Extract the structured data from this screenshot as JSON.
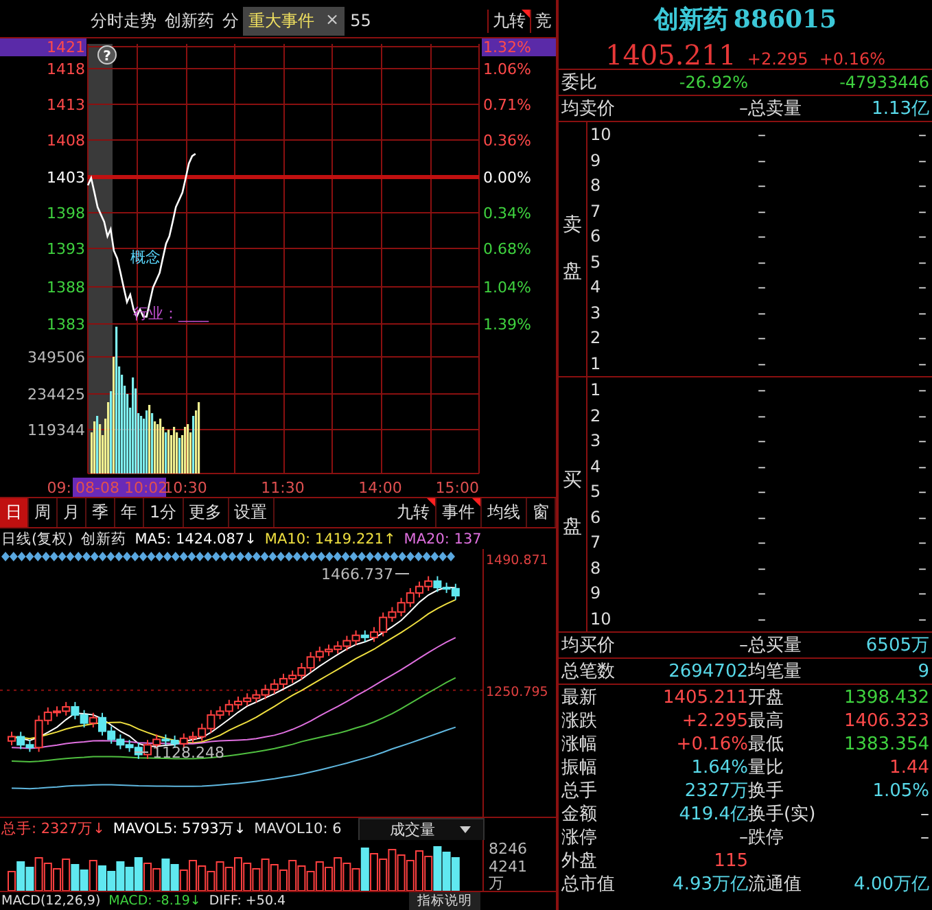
{
  "top_tabs": [
    {
      "label": "分时走势"
    },
    {
      "label": "创新药"
    },
    {
      "label": "分"
    }
  ],
  "event_popup": {
    "label": "重大事件",
    "close": "×",
    "trailing": "55"
  },
  "top_right_tabs": [
    {
      "label": "九转",
      "flagged": true
    },
    {
      "label": "竞",
      "flagged": false
    }
  ],
  "intraday": {
    "help": "?",
    "cursor_time": "08-08 10:02",
    "price_axis": [
      {
        "label": "1421",
        "kind": "up",
        "selected": true
      },
      {
        "label": "1418",
        "kind": "up",
        "selected": false
      },
      {
        "label": "1413",
        "kind": "up",
        "selected": false
      },
      {
        "label": "1408",
        "kind": "up",
        "selected": false
      },
      {
        "label": "1403",
        "kind": "flat",
        "selected": false
      },
      {
        "label": "1398",
        "kind": "down",
        "selected": false
      },
      {
        "label": "1393",
        "kind": "down",
        "selected": false
      },
      {
        "label": "1388",
        "kind": "down",
        "selected": false
      },
      {
        "label": "1383",
        "kind": "down",
        "selected": false
      }
    ],
    "percent_axis": [
      {
        "label": "1.32%",
        "kind": "up",
        "selected": true
      },
      {
        "label": "1.06%",
        "kind": "up",
        "selected": false
      },
      {
        "label": "0.71%",
        "kind": "up",
        "selected": false
      },
      {
        "label": "0.36%",
        "kind": "up",
        "selected": false
      },
      {
        "label": "0.00%",
        "kind": "flat",
        "selected": false
      },
      {
        "label": "0.34%",
        "kind": "down",
        "selected": false
      },
      {
        "label": "0.68%",
        "kind": "down",
        "selected": false
      },
      {
        "label": "1.04%",
        "kind": "down",
        "selected": false
      },
      {
        "label": "1.39%",
        "kind": "down",
        "selected": false
      }
    ],
    "volume_axis": [
      "349506",
      "234425",
      "119344"
    ],
    "time_axis": [
      "09:",
      "10:30",
      "11:30",
      "14:00",
      "15:00"
    ],
    "overlays": [
      {
        "text": "概念",
        "kind": "concept"
      },
      {
        "text": "行业：____",
        "kind": "industry"
      }
    ]
  },
  "period_tabs": [
    {
      "label": "日",
      "selected": true
    },
    {
      "label": "周",
      "selected": false
    },
    {
      "label": "月",
      "selected": false
    },
    {
      "label": "季",
      "selected": false
    },
    {
      "label": "年",
      "selected": false
    },
    {
      "label": "1分",
      "selected": false
    },
    {
      "label": "更多",
      "selected": false
    },
    {
      "label": "设置",
      "selected": false
    }
  ],
  "chart_tools": [
    {
      "label": "九转",
      "flagged": true
    },
    {
      "label": "事件",
      "flagged": true
    },
    {
      "label": "均线",
      "flagged": false
    },
    {
      "label": "窗",
      "flagged": false
    }
  ],
  "kline": {
    "legend": [
      {
        "text": "日线(复权)",
        "kind": "plain"
      },
      {
        "text": "创新药",
        "kind": "plain"
      },
      {
        "text": "MA5: 1424.087↓",
        "kind": "ma5"
      },
      {
        "text": "MA10: 1419.221↑",
        "kind": "ma10"
      },
      {
        "text": "MA20: 137",
        "kind": "ma20"
      }
    ],
    "axis": [
      "1490.871",
      "1250.795"
    ],
    "high_note": "1466.737",
    "low_note": "1128.248"
  },
  "volume": {
    "legend": [
      {
        "text": "总手: 2327万↓",
        "kind": "total"
      },
      {
        "text": "MAVOL5: 5793万↓",
        "kind": "ma5"
      },
      {
        "text": "MAVOL10: 6",
        "kind": "plain"
      }
    ],
    "indicator": "成交量",
    "axis": [
      "8246",
      "4241",
      "万"
    ]
  },
  "macd": {
    "legend": [
      {
        "text": "MACD(12,26,9)",
        "kind": "plain"
      },
      {
        "text": "MACD: -8.19↓",
        "kind": "down"
      },
      {
        "text": "DIFF: +50.4",
        "kind": "plain"
      }
    ],
    "help_button": "指标说明"
  },
  "quote": {
    "name": "创新药",
    "code": "886015",
    "price": "1405.211",
    "change": "+2.295",
    "change_pct": "+0.16%"
  },
  "ratio_row": {
    "label": "委比",
    "pct": "-26.92%",
    "diff": "-47933446"
  },
  "ask_summary": {
    "label": "均卖价",
    "value": "–",
    "total_label": "总卖量",
    "total": "1.13亿"
  },
  "asks": {
    "side_label": "卖盘",
    "levels": [
      {
        "level": "10",
        "price": "–",
        "volume": "–"
      },
      {
        "level": "9",
        "price": "–",
        "volume": "–"
      },
      {
        "level": "8",
        "price": "–",
        "volume": "–"
      },
      {
        "level": "7",
        "price": "–",
        "volume": "–"
      },
      {
        "level": "6",
        "price": "–",
        "volume": "–"
      },
      {
        "level": "5",
        "price": "–",
        "volume": "–"
      },
      {
        "level": "4",
        "price": "–",
        "volume": "–"
      },
      {
        "level": "3",
        "price": "–",
        "volume": "–"
      },
      {
        "level": "2",
        "price": "–",
        "volume": "–"
      },
      {
        "level": "1",
        "price": "–",
        "volume": "–"
      }
    ]
  },
  "bids": {
    "side_label": "买盘",
    "levels": [
      {
        "level": "1",
        "price": "–",
        "volume": "–"
      },
      {
        "level": "2",
        "price": "–",
        "volume": "–"
      },
      {
        "level": "3",
        "price": "–",
        "volume": "–"
      },
      {
        "level": "4",
        "price": "–",
        "volume": "–"
      },
      {
        "level": "5",
        "price": "–",
        "volume": "–"
      },
      {
        "level": "6",
        "price": "–",
        "volume": "–"
      },
      {
        "level": "7",
        "price": "–",
        "volume": "–"
      },
      {
        "level": "8",
        "price": "–",
        "volume": "–"
      },
      {
        "level": "9",
        "price": "–",
        "volume": "–"
      },
      {
        "level": "10",
        "price": "–",
        "volume": "–"
      }
    ]
  },
  "bid_summary": {
    "label": "均买价",
    "value": "–",
    "total_label": "总买量",
    "total": "6505万"
  },
  "trades_row": {
    "label": "总笔数",
    "value": "2694702",
    "avg_label": "均笔量",
    "avg": "9"
  },
  "stats": [
    {
      "cells": [
        {
          "label": "最新",
          "value": "1405.211",
          "kind": "up"
        },
        {
          "label": "开盘",
          "value": "1398.432",
          "kind": "down"
        }
      ]
    },
    {
      "cells": [
        {
          "label": "涨跌",
          "value": "+2.295",
          "kind": "up"
        },
        {
          "label": "最高",
          "value": "1406.323",
          "kind": "up"
        }
      ]
    },
    {
      "cells": [
        {
          "label": "涨幅",
          "value": "+0.16%",
          "kind": "up"
        },
        {
          "label": "最低",
          "value": "1383.354",
          "kind": "down"
        }
      ]
    },
    {
      "cells": [
        {
          "label": "振幅",
          "value": "1.64%",
          "kind": "info"
        },
        {
          "label": "量比",
          "value": "1.44",
          "kind": "up"
        }
      ]
    },
    {
      "cells": [
        {
          "label": "总手",
          "value": "2327万",
          "kind": "info"
        },
        {
          "label": "换手",
          "value": "1.05%",
          "kind": "info"
        }
      ]
    },
    {
      "cells": [
        {
          "label": "金额",
          "value": "419.4亿",
          "kind": "info"
        },
        {
          "label": "换手(实)",
          "value": "–",
          "kind": "plain"
        }
      ]
    },
    {
      "cells": [
        {
          "label": "涨停",
          "value": "–",
          "kind": "plain"
        },
        {
          "label": "跌停",
          "value": "–",
          "kind": "plain"
        }
      ]
    },
    {
      "cells": [
        {
          "label": "外盘",
          "value": "115",
          "kind": "up"
        }
      ]
    },
    {
      "cells": [
        {
          "label": "总市值",
          "value": "4.93万亿",
          "kind": "info"
        },
        {
          "label": "流通值",
          "value": "4.00万亿",
          "kind": "info"
        }
      ]
    }
  ]
}
